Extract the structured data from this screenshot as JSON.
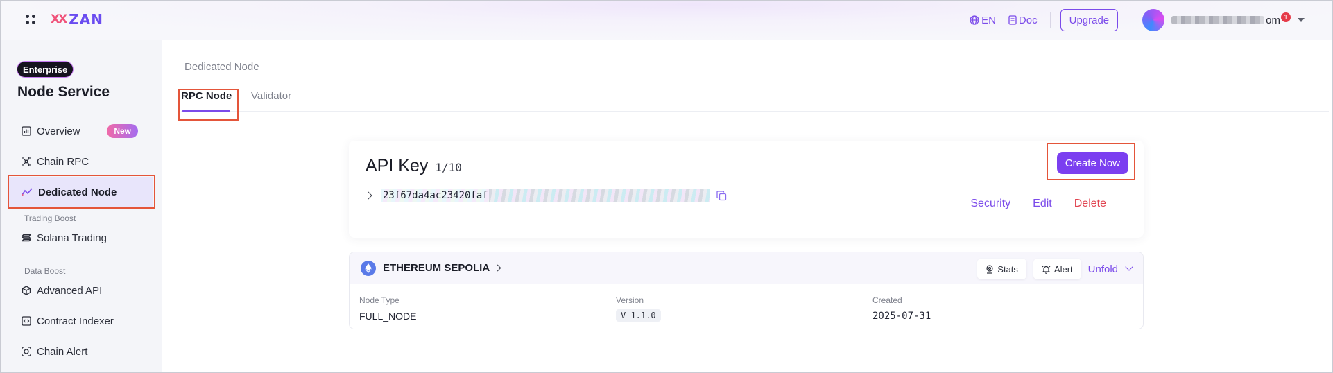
{
  "header": {
    "logo_mark": "XX",
    "logo_text": "ZAN",
    "language": "EN",
    "doc_label": "Doc",
    "upgrade_label": "Upgrade",
    "email_suffix": "om",
    "notification_count": "1"
  },
  "sidebar": {
    "badge": "Enterprise",
    "title": "Node Service",
    "items": [
      {
        "label": "Overview",
        "badge": "New"
      },
      {
        "label": "Chain RPC"
      },
      {
        "label": "Dedicated Node"
      },
      {
        "label": "Solana Trading"
      },
      {
        "label": "Advanced API"
      },
      {
        "label": "Contract Indexer"
      },
      {
        "label": "Chain Alert"
      }
    ],
    "groups": [
      "Trading Boost",
      "Data Boost"
    ]
  },
  "main": {
    "breadcrumb": "Dedicated Node",
    "tabs": [
      {
        "label": "RPC Node",
        "active": true
      },
      {
        "label": "Validator",
        "active": false
      }
    ],
    "api_key": {
      "title": "API Key",
      "count": "1/10",
      "create_label": "Create Now",
      "key_visible": "23f67da4ac23420faf",
      "actions": {
        "security": "Security",
        "edit": "Edit",
        "delete": "Delete"
      }
    },
    "node": {
      "network": "ETHEREUM SEPOLIA",
      "stats_label": "Stats",
      "alert_label": "Alert",
      "unfold_label": "Unfold",
      "fields": {
        "node_type_label": "Node Type",
        "node_type": "FULL_NODE",
        "version_label": "Version",
        "version": "V 1.1.0",
        "created_label": "Created",
        "created": "2025-07-31"
      }
    }
  },
  "colors": {
    "accent": "#7b4bea",
    "danger": "#e0434f",
    "highlight": "#e4553a"
  }
}
